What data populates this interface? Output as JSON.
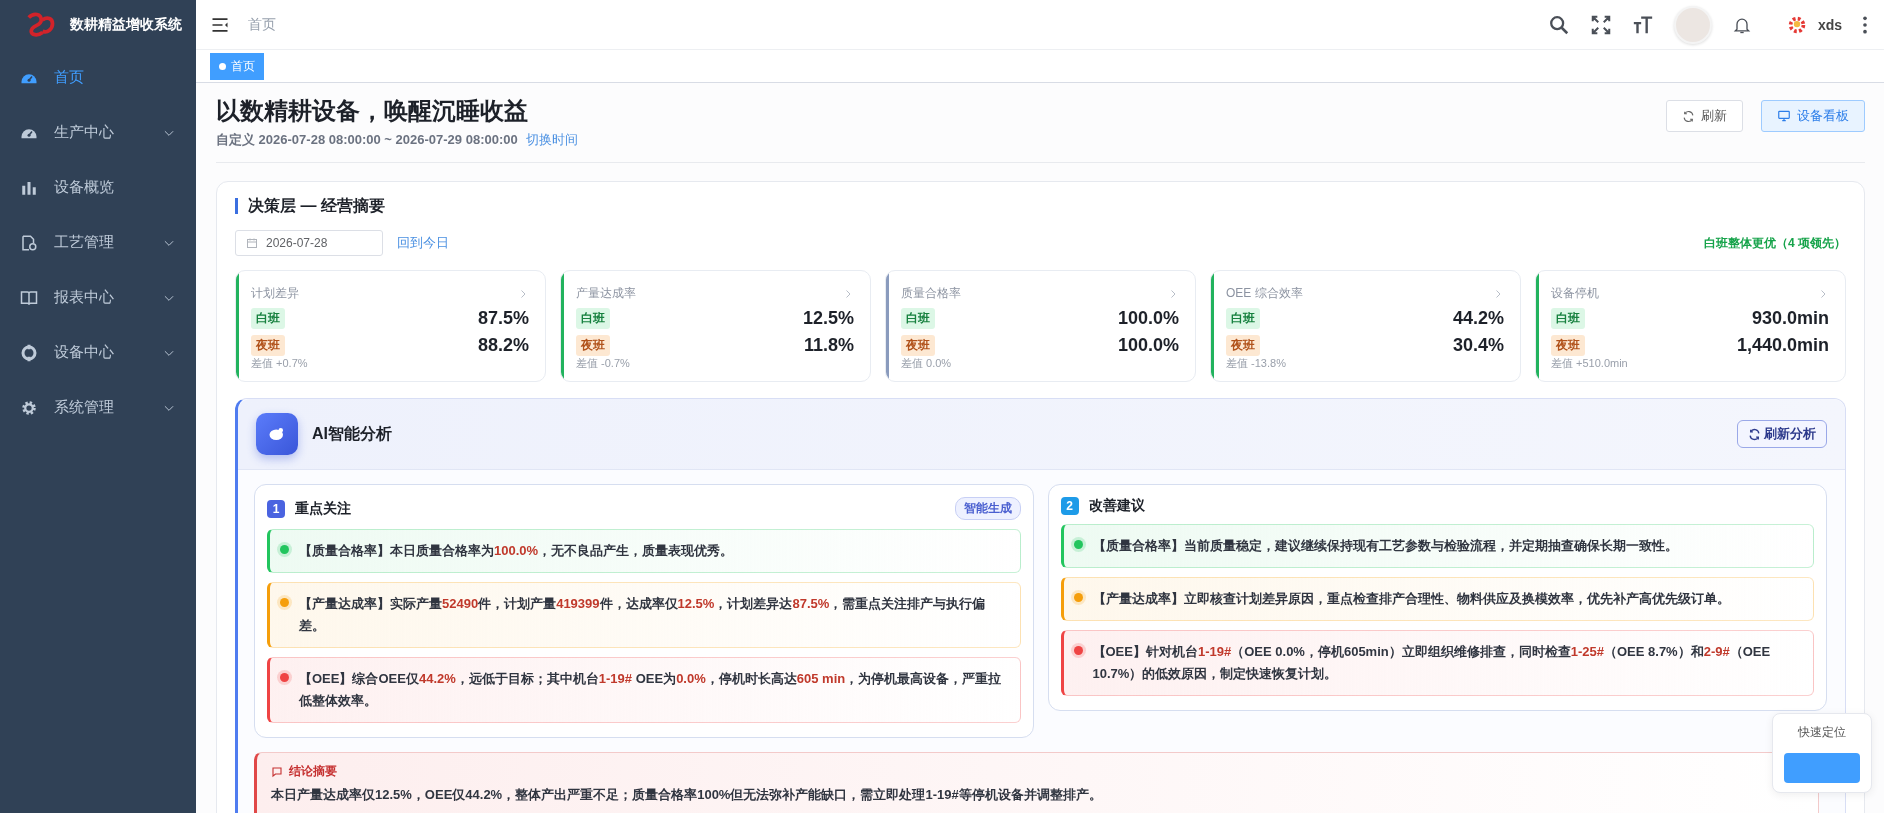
{
  "sidebar": {
    "title": "数耕精益增收系统",
    "items": [
      {
        "label": "首页",
        "selected": true,
        "has_children": false
      },
      {
        "label": "生产中心",
        "selected": false,
        "has_children": true
      },
      {
        "label": "设备概览",
        "selected": false,
        "has_children": false
      },
      {
        "label": "工艺管理",
        "selected": false,
        "has_children": true
      },
      {
        "label": "报表中心",
        "selected": false,
        "has_children": true
      },
      {
        "label": "设备中心",
        "selected": false,
        "has_children": true
      },
      {
        "label": "系统管理",
        "selected": false,
        "has_children": true
      }
    ]
  },
  "header": {
    "breadcrumb": "首页",
    "user": "xds"
  },
  "tabs": [
    {
      "label": "首页",
      "selected": true
    }
  ],
  "page": {
    "title": "以数精耕设备，唤醒沉睡收益",
    "range": "自定义 2026-07-28 08:00:00 ~ 2026-07-29 08:00:00",
    "switch_link": "切换时间",
    "buttons": [
      {
        "label": "刷新",
        "kind": "default"
      },
      {
        "label": "设备看板",
        "kind": "primary"
      }
    ]
  },
  "summary": {
    "title": "决策层 — 经营摘要",
    "date": "2026-07-28",
    "today_link": "回到今日",
    "verdict": "白班整体更优（4 项领先）",
    "cards": [
      {
        "title": "计划差异",
        "color": "#22b35e",
        "shifts": [
          {
            "label": "白班",
            "kind": "day",
            "value": "87.5%"
          },
          {
            "label": "夜班",
            "kind": "night",
            "value": "88.2%"
          }
        ],
        "diff": "差值 +0.7%"
      },
      {
        "title": "产量达成率",
        "color": "#22b35e",
        "shifts": [
          {
            "label": "白班",
            "kind": "day",
            "value": "12.5%"
          },
          {
            "label": "夜班",
            "kind": "night",
            "value": "11.8%"
          }
        ],
        "diff": "差值 -0.7%"
      },
      {
        "title": "质量合格率",
        "color": "#8a9bbd",
        "shifts": [
          {
            "label": "白班",
            "kind": "day",
            "value": "100.0%"
          },
          {
            "label": "夜班",
            "kind": "night",
            "value": "100.0%"
          }
        ],
        "diff": "差值 0.0%"
      },
      {
        "title": "OEE 综合效率",
        "color": "#22b35e",
        "shifts": [
          {
            "label": "白班",
            "kind": "day",
            "value": "44.2%"
          },
          {
            "label": "夜班",
            "kind": "night",
            "value": "30.4%"
          }
        ],
        "diff": "差值 -13.8%"
      },
      {
        "title": "设备停机",
        "color": "#22b35e",
        "shifts": [
          {
            "label": "白班",
            "kind": "day",
            "value": "930.0min"
          },
          {
            "label": "夜班",
            "kind": "night",
            "value": "1,440.0min"
          }
        ],
        "diff": "差值 +510.0min"
      }
    ]
  },
  "ai": {
    "title": "AI智能分析",
    "refresh": "刷新分析",
    "panels": [
      {
        "number": "1",
        "title": "重点关注",
        "badge": "智能生成",
        "items": [
          {
            "color": "#22c55e",
            "text": "【质量合格率】本日质量合格率为**100.0%**，无不良品产生，质量表现优秀。"
          },
          {
            "color": "#f59e0b",
            "text": "【产量达成率】实际产量**52490**件，计划产量**419399**件，达成率仅**12.5%**，计划差异达**87.5%**，需重点关注排产与执行偏差。"
          },
          {
            "color": "#ef4444",
            "text": "【OEE】综合OEE仅**44.2%**，远低于目标；其中机台**1-19#** OEE为**0.0%**，停机时长高达**605 min**，为停机最高设备，严重拉低整体效率。"
          }
        ]
      },
      {
        "number": "2",
        "title": "改善建议",
        "items": [
          {
            "color": "#22c55e",
            "text": "【质量合格率】当前质量稳定，建议继续保持现有工艺参数与检验流程，并定期抽查确保长期一致性。"
          },
          {
            "color": "#f59e0b",
            "text": "【产量达成率】立即核查计划差异原因，重点检查排产合理性、物料供应及换模效率，优先补产高优先级订单。"
          },
          {
            "color": "#ef4444",
            "text": "【OEE】针对机台**1-19#**（OEE 0.0%，停机605min）立即组织维修排查，同时检查**1-25#**（OEE 8.7%）和**2-9#**（OEE 10.7%）的低效原因，制定快速恢复计划。"
          }
        ]
      }
    ],
    "conclusion": {
      "title": "结论摘要",
      "text": "本日产量达成率仅12.5%，OEE仅44.2%，整体产出严重不足；质量合格率100%但无法弥补产能缺口，需立即处理1-19#等停机设备并调整排产。"
    }
  },
  "quick_nav": {
    "title": "快速定位"
  }
}
